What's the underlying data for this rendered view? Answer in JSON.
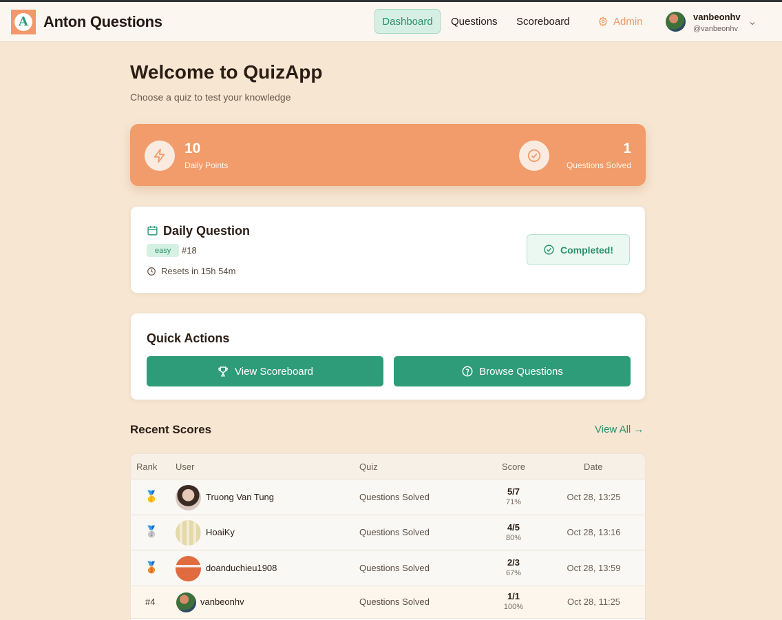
{
  "header": {
    "logo_letter": "A",
    "brand": "Anton Questions",
    "nav": {
      "dashboard": "Dashboard",
      "questions": "Questions",
      "scoreboard": "Scoreboard",
      "admin": "Admin"
    },
    "user": {
      "name": "vanbeonhv",
      "handle": "@vanbeonhv"
    }
  },
  "page": {
    "title": "Welcome to QuizApp",
    "subtitle": "Choose a quiz to test your knowledge"
  },
  "stats": {
    "daily_points": {
      "value": "10",
      "label": "Daily Points",
      "icon": "lightning-icon"
    },
    "questions_solved": {
      "value": "1",
      "label": "Questions Solved",
      "icon": "check-circle-icon"
    }
  },
  "daily_question": {
    "title": "Daily Question",
    "difficulty": "easy",
    "number": "#18",
    "reset": "Resets in 15h 54m",
    "status": "Completed!"
  },
  "quick_actions": {
    "title": "Quick Actions",
    "scoreboard_btn": "View Scoreboard",
    "browse_btn": "Browse Questions"
  },
  "recent_scores": {
    "title": "Recent Scores",
    "view_all": "View All →",
    "columns": [
      "Rank",
      "User",
      "Quiz",
      "Score",
      "Date"
    ],
    "rows": [
      {
        "rank": "🥇",
        "user": "Truong Van Tung",
        "quiz": "Questions Solved",
        "score": "5/7",
        "pct": "71%",
        "date": "Oct 28, 13:25"
      },
      {
        "rank": "🥈",
        "user": "HoaiKy",
        "quiz": "Questions Solved",
        "score": "4/5",
        "pct": "80%",
        "date": "Oct 28, 13:16"
      },
      {
        "rank": "🥉",
        "user": "doanduchieu1908",
        "quiz": "Questions Solved",
        "score": "2/3",
        "pct": "67%",
        "date": "Oct 28, 13:59"
      },
      {
        "rank": "#4",
        "user": "vanbeonhv",
        "quiz": "Questions Solved",
        "score": "1/1",
        "pct": "100%",
        "date": "Oct 28, 11:25"
      }
    ]
  },
  "colors": {
    "accent": "#2e9b79",
    "orange": "#f19c6a",
    "background": "#f6e6d2"
  }
}
